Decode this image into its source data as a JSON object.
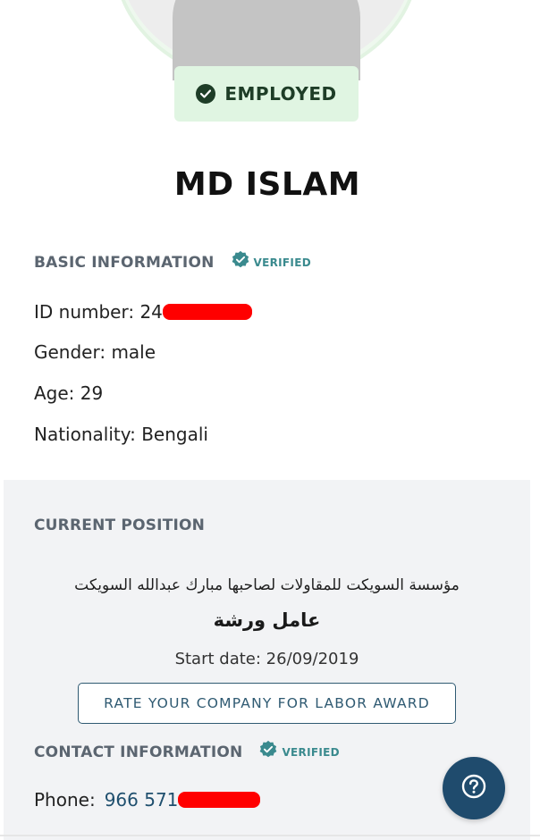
{
  "profile": {
    "status": "EMPLOYED",
    "name": "MD ISLAM"
  },
  "basic_info": {
    "title": "BASIC INFORMATION",
    "verified_label": "VERIFIED",
    "id_label": "ID number: 24",
    "gender": "Gender: male",
    "age": "Age: 29",
    "nationality": "Nationality: Bengali"
  },
  "current_position": {
    "title": "CURRENT POSITION",
    "company": "مؤسسة السويكت للمقاولات لصاحبها مبارك عبدالله السويكت",
    "job_title": "عامل ورشة",
    "start_date_label": "Start date:",
    "start_date_value": "26/09/2019",
    "rate_button_label": "RATE YOUR COMPANY FOR LABOR AWARD"
  },
  "contact_info": {
    "title": "CONTACT INFORMATION",
    "verified_label": "VERIFIED",
    "phone_label": "Phone:",
    "phone_value": "966 571"
  },
  "icons": {
    "status": "check-circle-icon",
    "verified": "verified-badge-icon",
    "help": "help-icon"
  },
  "colors": {
    "status_bg": "#e0f5e2",
    "status_text": "#1e3d27",
    "accent": "#1f4b6d",
    "verified": "#3a8a8e"
  }
}
